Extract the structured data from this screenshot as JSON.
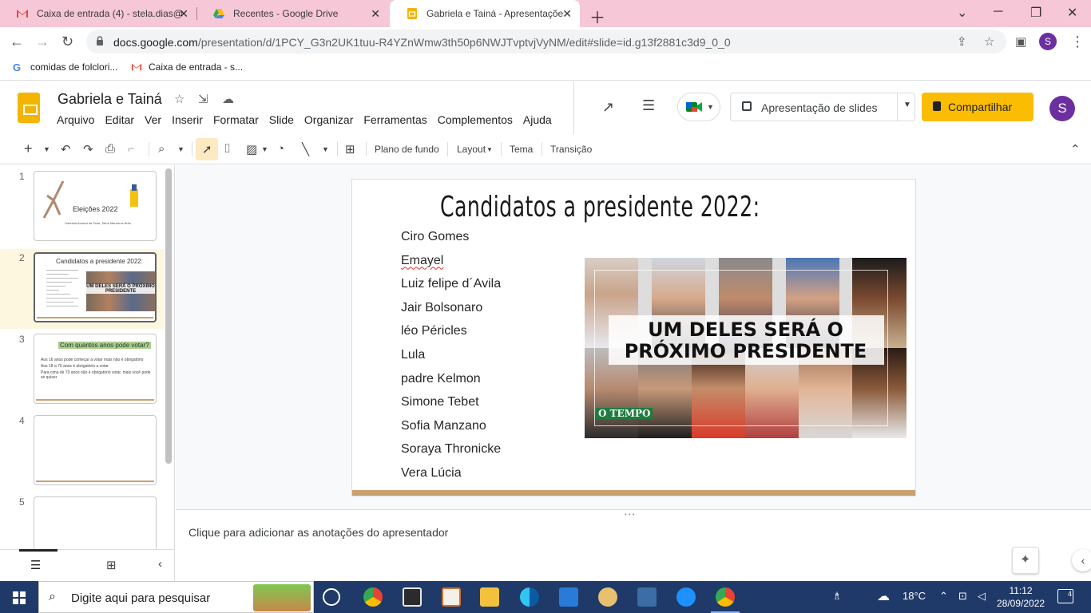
{
  "browser": {
    "tabs": [
      {
        "title": "Caixa de entrada (4) - stela.dias@",
        "icon": "gmail-icon"
      },
      {
        "title": "Recentes - Google Drive",
        "icon": "drive-icon"
      },
      {
        "title": "Gabriela e Tainá - Apresentações",
        "icon": "slides-icon"
      }
    ],
    "url_host": "docs.google.com",
    "url_path": "/presentation/d/1PCY_G3n2UK1tuu-R4YZnWmw3th50p6NWJTvptvjVyNM/edit#slide=id.g13f2881c3d9_0_0",
    "profile_initial": "S",
    "bookmarks": [
      {
        "label": "comidas de folclori...",
        "icon": "google-icon"
      },
      {
        "label": "Caixa de entrada - s...",
        "icon": "gmail-icon"
      }
    ]
  },
  "app": {
    "title": "Gabriela e Tainá",
    "menu": [
      "Arquivo",
      "Editar",
      "Ver",
      "Inserir",
      "Formatar",
      "Slide",
      "Organizar",
      "Ferramentas",
      "Complementos",
      "Ajuda"
    ],
    "slideshow_label": "Apresentação de slides",
    "share_label": "Compartilhar",
    "avatar_initial": "S",
    "brand_color": "#f4b400",
    "share_color": "#fbbc04"
  },
  "toolbar": {
    "background": "Plano de fundo",
    "layout": "Layout",
    "theme": "Tema",
    "transition": "Transição"
  },
  "filmstrip": {
    "slides": [
      {
        "num": "1",
        "title": "Eleições 2022",
        "subtitle": "Gabriela Amaral da Sivla, Tainá Marreiros Brito"
      },
      {
        "num": "2",
        "title": "Candidatos a presidente 2022:",
        "band": "UM DELES SERÁ O PRÓXIMO PRESIDENTE"
      },
      {
        "num": "3",
        "title": "Com quantos anos pode votar?",
        "lines": [
          "Aos 16 anos pode começar a votar mais não é obrigatório",
          "Aos 18 a 70 anos é obrigatório a votar",
          "Para cima de 70 anos não é obrigatório votar, mais você pode se quiser"
        ]
      },
      {
        "num": "4"
      },
      {
        "num": "5"
      }
    ]
  },
  "slide": {
    "title": "Candidatos a presidente 2022:",
    "candidates": [
      "Ciro Gomes",
      "Emayel",
      "Luiz felipe d´Avila",
      "Jair Bolsonaro",
      "léo Péricles",
      "Lula",
      "padre Kelmon",
      "Simone Tebet",
      "Sofia Manzano",
      "Soraya Thronicke",
      "Vera Lúcia"
    ],
    "image_band_line1": "UM DELES SERÁ O",
    "image_band_line2": "PRÓXIMO PRESIDENTE",
    "image_watermark": "O TEMPO",
    "accent_color": "#c9a16f"
  },
  "notes": {
    "placeholder": "Clique para adicionar as anotações do apresentador"
  },
  "taskbar": {
    "search_placeholder": "Digite aqui para pesquisar",
    "temperature": "18°C",
    "time": "11:12",
    "date": "28/09/2022",
    "notification_count": "4"
  }
}
